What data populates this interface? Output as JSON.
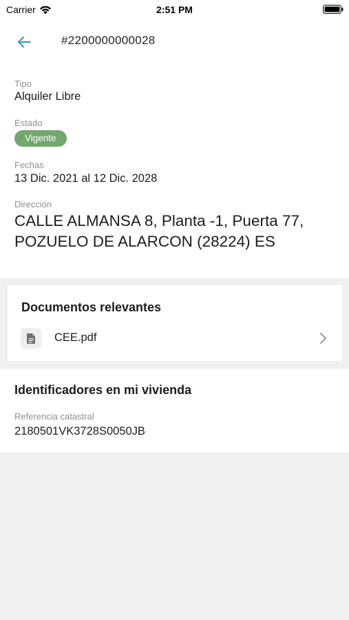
{
  "status_bar": {
    "carrier": "Carrier",
    "time": "2:51 PM"
  },
  "header": {
    "title": "#2200000000028",
    "back_icon": "arrow-left-icon",
    "accent": "#4a9bb8"
  },
  "details": {
    "tipo_label": "Tipo",
    "tipo_value": "Alquiler Libre",
    "estado_label": "Estado",
    "estado_value": "Vigente",
    "estado_color": "#72a86e",
    "fechas_label": "Fechas",
    "fechas_value": "13 Dic. 2021 al 12 Dic. 2028",
    "direccion_label": "Dirección",
    "direccion_value": "CALLE ALMANSA 8, Planta -1, Puerta 77, POZUELO DE ALARCON (28224) ES"
  },
  "documents": {
    "heading": "Documentos relevantes",
    "items": [
      {
        "name": "CEE.pdf",
        "icon": "file-icon"
      }
    ]
  },
  "identifiers": {
    "heading": "Identificadores en mi vivienda",
    "ref_label": "Referencia catastral",
    "ref_value": "2180501VK3728S0050JB"
  }
}
